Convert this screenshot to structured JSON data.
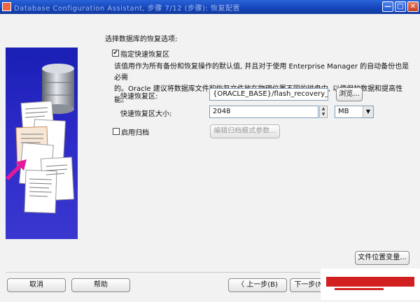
{
  "window": {
    "title": "Database Configuration Assistant, 步骤 7/12 (步骤): 恢复配置",
    "btn_minimize": "—",
    "btn_maximize": "□",
    "btn_close": "✕"
  },
  "section_heading": "选择数据库的恢复选项:",
  "fra": {
    "checkbox_label": "指定快速恢复区",
    "checked": true,
    "description_line1": "该值用作为所有备份和恢复操作的默认值, 并且对于使用 Enterprise Manager 的自动备份也是必需",
    "description_line2": "的。Oracle 建议将数据库文件和恢复文件放在物理位置不同的磁盘中, 以便保护数据和提高性能。",
    "location_label": "快速恢复区:",
    "location_value": "{ORACLE_BASE}/flash_recovery_area",
    "browse_label": "浏览...",
    "size_label": "快速恢复区大小:",
    "size_value": "2048",
    "unit_value": "MB"
  },
  "archive": {
    "checkbox_label": "启用归档",
    "checked": false,
    "edit_params_label": "编辑归档模式参数..."
  },
  "file_location_vars_label": "文件位置变量...",
  "footer": {
    "cancel": "取消",
    "help": "帮助",
    "back": "上一步(B)",
    "next": "下一步(N)"
  }
}
